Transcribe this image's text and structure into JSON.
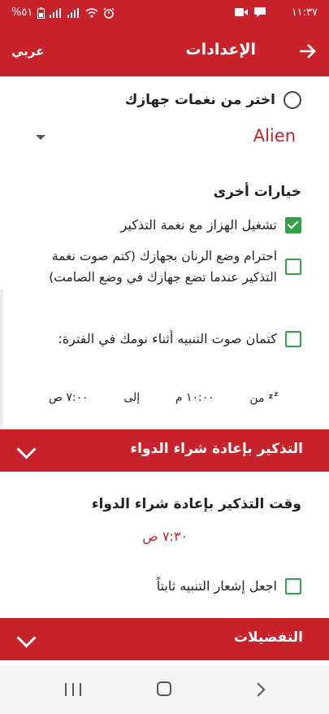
{
  "status_bar": {
    "time": "١١:٣٧",
    "battery": "%٥١"
  },
  "app_bar": {
    "title": "الإعدادات",
    "language_button": "عربي"
  },
  "ringtone": {
    "radio_label": "اختر من نغمات جهازك",
    "selected_tone": "Alien"
  },
  "other_options": {
    "title": "خيارات أخرى",
    "vibrate_label": "تشغيل الهزاز مع نغمة التذكير",
    "vibrate_checked": true,
    "respect_ringer_label": "احترام وضع الرنان بجهازك (كتم صوت نغمة التذكير عندما تضع جهازك في وضع الصامت)",
    "respect_ringer_checked": false,
    "mute_sleep_label": "كتمان صوت التنبيه أثناء نومك في الفترة:",
    "mute_sleep_checked": false,
    "sleep_from_label": "من",
    "sleep_from_time": "١٠:٠٠ م",
    "sleep_to_label": "إلى",
    "sleep_to_time": "٧:٠٠ ص"
  },
  "refill_section": {
    "header": "التذكير بإعادة شراء الدواء",
    "time_title": "وقت التذكير بإعادة شراء الدواء",
    "time_value": "٧:٣٠ ص",
    "persistent_label": "اجعل إشعار التنبيه ثابتاً",
    "persistent_checked": false
  },
  "preferences_section": {
    "header": "التفضيلات"
  },
  "colors": {
    "primary": "#c8222a",
    "checkbox": "#35a04a"
  }
}
